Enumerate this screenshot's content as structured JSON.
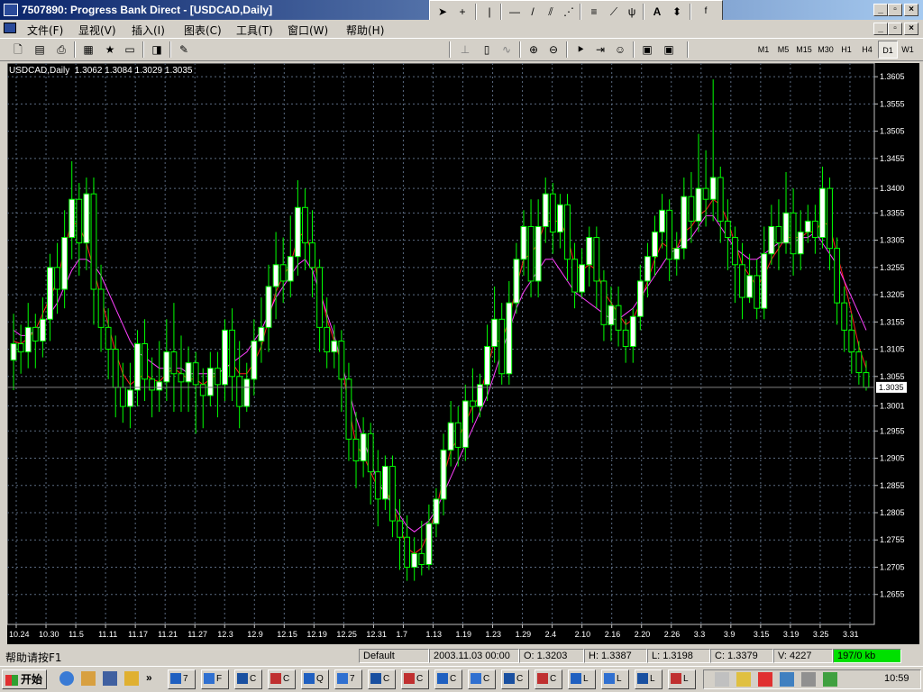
{
  "window": {
    "title": "7507890: Progress Bank Direct - [USDCAD,Daily]"
  },
  "menu": [
    "文件(F)",
    "显视(V)",
    "插入(I)",
    "图表(C)",
    "工具(T)",
    "窗口(W)",
    "帮助(H)"
  ],
  "timeframes": [
    "M1",
    "M5",
    "M15",
    "M30",
    "H1",
    "H4",
    "D1",
    "W1"
  ],
  "active_timeframe": "D1",
  "chart_data": {
    "type": "candlestick",
    "header": "USDCAD,Daily  1.3062 1.3084 1.3029 1.3035",
    "current_price_label": "1.3035",
    "ylim": [
      1.26,
      1.363
    ],
    "y_ticks": [
      "1.3605",
      "1.3555",
      "1.3505",
      "1.3455",
      "1.3400",
      "1.3355",
      "1.3305",
      "1.3255",
      "1.3205",
      "1.3155",
      "1.3105",
      "1.3055",
      "1.3001",
      "1.2955",
      "1.2905",
      "1.2855",
      "1.2805",
      "1.2755",
      "1.2705",
      "1.2655"
    ],
    "x_ticks": [
      "10.24",
      "10.30",
      "11.5",
      "11.11",
      "11.17",
      "11.21",
      "11.27",
      "12.3",
      "12.9",
      "12.15",
      "12.19",
      "12.25",
      "12.31",
      "1.7",
      "1.13",
      "1.19",
      "1.23",
      "1.29",
      "2.4",
      "2.10",
      "2.16",
      "2.20",
      "2.26",
      "3.3",
      "3.9",
      "3.15",
      "3.19",
      "3.25",
      "3.31"
    ],
    "colors": {
      "bull": "#ffffff",
      "bear": "#000000",
      "wick": "#00ff00",
      "grid": "#5a6a80",
      "text": "#ffffff"
    },
    "candles": [
      [
        1.3085,
        1.3115,
        1.317,
        1.303
      ],
      [
        1.3115,
        1.31,
        1.315,
        1.306
      ],
      [
        1.31,
        1.3145,
        1.319,
        1.307
      ],
      [
        1.3145,
        1.312,
        1.317,
        1.307
      ],
      [
        1.312,
        1.316,
        1.32,
        1.309
      ],
      [
        1.316,
        1.3255,
        1.328,
        1.312
      ],
      [
        1.3255,
        1.3215,
        1.33,
        1.317
      ],
      [
        1.3215,
        1.331,
        1.336,
        1.318
      ],
      [
        1.331,
        1.338,
        1.345,
        1.327
      ],
      [
        1.338,
        1.33,
        1.341,
        1.324
      ],
      [
        1.33,
        1.339,
        1.342,
        1.325
      ],
      [
        1.339,
        1.3215,
        1.342,
        1.315
      ],
      [
        1.3215,
        1.3145,
        1.326,
        1.31
      ],
      [
        1.3145,
        1.3105,
        1.318,
        1.305
      ],
      [
        1.3105,
        1.3035,
        1.313,
        1.298
      ],
      [
        1.3035,
        1.3,
        1.308,
        1.297
      ],
      [
        1.3,
        1.303,
        1.308,
        1.296
      ],
      [
        1.303,
        1.3115,
        1.314,
        1.3
      ],
      [
        1.3115,
        1.305,
        1.316,
        1.301
      ],
      [
        1.305,
        1.303,
        1.309,
        1.298
      ],
      [
        1.303,
        1.3045,
        1.312,
        1.299
      ],
      [
        1.3045,
        1.31,
        1.316,
        1.301
      ],
      [
        1.31,
        1.306,
        1.319,
        1.299
      ],
      [
        1.306,
        1.3045,
        1.313,
        1.299
      ],
      [
        1.3045,
        1.308,
        1.311,
        1.299
      ],
      [
        1.308,
        1.304,
        1.31,
        1.295
      ],
      [
        1.304,
        1.302,
        1.307,
        1.296
      ],
      [
        1.302,
        1.307,
        1.31,
        1.3
      ],
      [
        1.307,
        1.304,
        1.31,
        1.298
      ],
      [
        1.304,
        1.314,
        1.316,
        1.301
      ],
      [
        1.314,
        1.3055,
        1.318,
        1.301
      ],
      [
        1.3055,
        1.3,
        1.312,
        1.296
      ],
      [
        1.3,
        1.305,
        1.308,
        1.299
      ],
      [
        1.305,
        1.312,
        1.316,
        1.302
      ],
      [
        1.312,
        1.3145,
        1.32,
        1.308
      ],
      [
        1.3145,
        1.322,
        1.326,
        1.31
      ],
      [
        1.322,
        1.326,
        1.332,
        1.316
      ],
      [
        1.326,
        1.323,
        1.331,
        1.319
      ],
      [
        1.323,
        1.3275,
        1.335,
        1.32
      ],
      [
        1.3275,
        1.3365,
        1.3415,
        1.324
      ],
      [
        1.3365,
        1.33,
        1.34,
        1.325
      ],
      [
        1.33,
        1.3255,
        1.336,
        1.32
      ],
      [
        1.3255,
        1.3145,
        1.327,
        1.31
      ],
      [
        1.3145,
        1.31,
        1.32,
        1.307
      ],
      [
        1.31,
        1.312,
        1.315,
        1.307
      ],
      [
        1.312,
        1.305,
        1.314,
        1.299
      ],
      [
        1.305,
        1.294,
        1.308,
        1.29
      ],
      [
        1.294,
        1.29,
        1.299,
        1.285
      ],
      [
        1.29,
        1.295,
        1.298,
        1.287
      ],
      [
        1.295,
        1.288,
        1.297,
        1.282
      ],
      [
        1.288,
        1.283,
        1.292,
        1.278
      ],
      [
        1.283,
        1.289,
        1.291,
        1.281
      ],
      [
        1.289,
        1.279,
        1.291,
        1.276
      ],
      [
        1.279,
        1.276,
        1.283,
        1.27
      ],
      [
        1.276,
        1.2705,
        1.28,
        1.268
      ],
      [
        1.2705,
        1.273,
        1.276,
        1.268
      ],
      [
        1.273,
        1.271,
        1.279,
        1.269
      ],
      [
        1.271,
        1.2785,
        1.282,
        1.27
      ],
      [
        1.2785,
        1.283,
        1.285,
        1.276
      ],
      [
        1.283,
        1.292,
        1.295,
        1.28
      ],
      [
        1.292,
        1.297,
        1.301,
        1.289
      ],
      [
        1.297,
        1.2925,
        1.3,
        1.289
      ],
      [
        1.2925,
        1.301,
        1.304,
        1.29
      ],
      [
        1.301,
        1.3,
        1.307,
        1.297
      ],
      [
        1.3,
        1.304,
        1.306,
        1.298
      ],
      [
        1.304,
        1.311,
        1.315,
        1.301
      ],
      [
        1.311,
        1.316,
        1.322,
        1.308
      ],
      [
        1.316,
        1.306,
        1.319,
        1.304
      ],
      [
        1.306,
        1.319,
        1.323,
        1.304
      ],
      [
        1.319,
        1.327,
        1.33,
        1.317
      ],
      [
        1.327,
        1.333,
        1.336,
        1.324
      ],
      [
        1.333,
        1.323,
        1.338,
        1.32
      ],
      [
        1.323,
        1.333,
        1.338,
        1.32
      ],
      [
        1.333,
        1.339,
        1.342,
        1.33
      ],
      [
        1.339,
        1.332,
        1.341,
        1.328
      ],
      [
        1.332,
        1.337,
        1.339,
        1.329
      ],
      [
        1.337,
        1.327,
        1.339,
        1.323
      ],
      [
        1.327,
        1.321,
        1.33,
        1.318
      ],
      [
        1.321,
        1.326,
        1.329,
        1.32
      ],
      [
        1.326,
        1.331,
        1.333,
        1.322
      ],
      [
        1.331,
        1.323,
        1.333,
        1.318
      ],
      [
        1.323,
        1.315,
        1.325,
        1.312
      ],
      [
        1.315,
        1.3185,
        1.322,
        1.312
      ],
      [
        1.3185,
        1.314,
        1.322,
        1.311
      ],
      [
        1.314,
        1.311,
        1.316,
        1.308
      ],
      [
        1.311,
        1.3165,
        1.318,
        1.308
      ],
      [
        1.3165,
        1.323,
        1.326,
        1.314
      ],
      [
        1.323,
        1.3275,
        1.33,
        1.32
      ],
      [
        1.3275,
        1.332,
        1.335,
        1.324
      ],
      [
        1.332,
        1.336,
        1.339,
        1.329
      ],
      [
        1.336,
        1.327,
        1.338,
        1.323
      ],
      [
        1.327,
        1.329,
        1.332,
        1.324
      ],
      [
        1.329,
        1.3385,
        1.342,
        1.327
      ],
      [
        1.3385,
        1.334,
        1.343,
        1.33
      ],
      [
        1.334,
        1.34,
        1.35,
        1.332
      ],
      [
        1.34,
        1.338,
        1.347,
        1.333
      ],
      [
        1.338,
        1.342,
        1.36,
        1.334
      ],
      [
        1.342,
        1.334,
        1.344,
        1.33
      ],
      [
        1.334,
        1.331,
        1.338,
        1.325
      ],
      [
        1.331,
        1.326,
        1.333,
        1.319
      ],
      [
        1.326,
        1.32,
        1.33,
        1.316
      ],
      [
        1.32,
        1.324,
        1.328,
        1.319
      ],
      [
        1.324,
        1.318,
        1.327,
        1.316
      ],
      [
        1.318,
        1.328,
        1.333,
        1.316
      ],
      [
        1.328,
        1.333,
        1.337,
        1.326
      ],
      [
        1.333,
        1.33,
        1.338,
        1.325
      ],
      [
        1.33,
        1.3355,
        1.343,
        1.328
      ],
      [
        1.3355,
        1.328,
        1.34,
        1.324
      ],
      [
        1.328,
        1.332,
        1.336,
        1.325
      ],
      [
        1.332,
        1.334,
        1.337,
        1.33
      ],
      [
        1.334,
        1.331,
        1.337,
        1.328
      ],
      [
        1.331,
        1.34,
        1.344,
        1.329
      ],
      [
        1.34,
        1.329,
        1.342,
        1.325
      ],
      [
        1.329,
        1.319,
        1.331,
        1.315
      ],
      [
        1.319,
        1.314,
        1.322,
        1.31
      ],
      [
        1.314,
        1.31,
        1.317,
        1.306
      ],
      [
        1.31,
        1.3062,
        1.312,
        1.304
      ],
      [
        1.3062,
        1.3035,
        1.3084,
        1.3029
      ]
    ],
    "ma_lines": [
      {
        "color": "#ff2020",
        "values": [
          1.312,
          1.3115,
          1.3125,
          1.314,
          1.317,
          1.32,
          1.323,
          1.329,
          1.334,
          1.333,
          1.33,
          1.325,
          1.32,
          1.315,
          1.31,
          1.306,
          1.304,
          1.305,
          1.306,
          1.305,
          1.3045,
          1.306,
          1.307,
          1.306,
          1.305,
          1.305,
          1.304,
          1.305,
          1.306,
          1.307,
          1.308,
          1.306,
          1.306,
          1.308,
          1.311,
          1.316,
          1.321,
          1.324,
          1.326,
          1.331,
          1.332,
          1.328,
          1.322,
          1.316,
          1.312,
          1.308,
          1.3,
          1.293,
          1.291,
          1.288,
          1.285,
          1.285,
          1.282,
          1.278,
          1.274,
          1.273,
          1.274,
          1.277,
          1.281,
          1.287,
          1.292,
          1.294,
          1.297,
          1.3,
          1.302,
          1.307,
          1.312,
          1.312,
          1.316,
          1.322,
          1.327,
          1.328,
          1.33,
          1.334,
          1.334,
          1.334,
          1.331,
          1.326,
          1.325,
          1.326,
          1.325,
          1.321,
          1.319,
          1.317,
          1.315,
          1.316,
          1.319,
          1.323,
          1.327,
          1.33,
          1.329,
          1.329,
          1.332,
          1.333,
          1.335,
          1.336,
          1.338,
          1.337,
          1.334,
          1.33,
          1.326,
          1.324,
          1.322,
          1.324,
          1.327,
          1.329,
          1.331,
          1.331,
          1.331,
          1.332,
          1.332,
          1.334,
          1.333,
          1.328,
          1.323,
          1.317,
          1.311,
          1.307
        ]
      },
      {
        "color": "#ff40ff",
        "values": [
          1.314,
          1.313,
          1.313,
          1.314,
          1.315,
          1.317,
          1.319,
          1.322,
          1.325,
          1.327,
          1.327,
          1.326,
          1.324,
          1.321,
          1.318,
          1.315,
          1.312,
          1.31,
          1.309,
          1.308,
          1.307,
          1.307,
          1.307,
          1.307,
          1.306,
          1.306,
          1.306,
          1.306,
          1.306,
          1.307,
          1.308,
          1.309,
          1.31,
          1.312,
          1.314,
          1.317,
          1.32,
          1.322,
          1.324,
          1.326,
          1.327,
          1.325,
          1.321,
          1.317,
          1.313,
          1.308,
          1.303,
          1.298,
          1.294,
          1.29,
          1.286,
          1.284,
          1.282,
          1.28,
          1.278,
          1.277,
          1.278,
          1.279,
          1.281,
          1.284,
          1.287,
          1.29,
          1.293,
          1.296,
          1.299,
          1.302,
          1.306,
          1.31,
          1.314,
          1.318,
          1.321,
          1.323,
          1.325,
          1.327,
          1.327,
          1.325,
          1.323,
          1.321,
          1.32,
          1.319,
          1.318,
          1.317,
          1.316,
          1.316,
          1.317,
          1.318,
          1.32,
          1.322,
          1.324,
          1.326,
          1.328,
          1.329,
          1.33,
          1.331,
          1.333,
          1.335,
          1.335,
          1.333,
          1.331,
          1.329,
          1.328,
          1.327,
          1.327,
          1.328,
          1.329,
          1.33,
          1.33,
          1.33,
          1.331,
          1.331,
          1.332,
          1.33,
          1.328,
          1.326,
          1.323,
          1.32,
          1.317,
          1.314
        ]
      }
    ]
  },
  "status": {
    "help": "帮助请按F1",
    "profile": "Default",
    "datetime": "2003.11.03 00:00",
    "open": "O: 1.3203",
    "high": "H: 1.3387",
    "low": "L: 1.3198",
    "close": "C: 1.3379",
    "volume": "V: 4227",
    "traffic": "197/0 kb"
  },
  "taskbar": {
    "start_label": "开始",
    "tasks": [
      "7",
      "F",
      "C",
      "C",
      "Q",
      "7",
      "C",
      "C",
      "C",
      "C",
      "C",
      "C",
      "L",
      "L",
      "L",
      "L"
    ],
    "clock": "10:59"
  }
}
